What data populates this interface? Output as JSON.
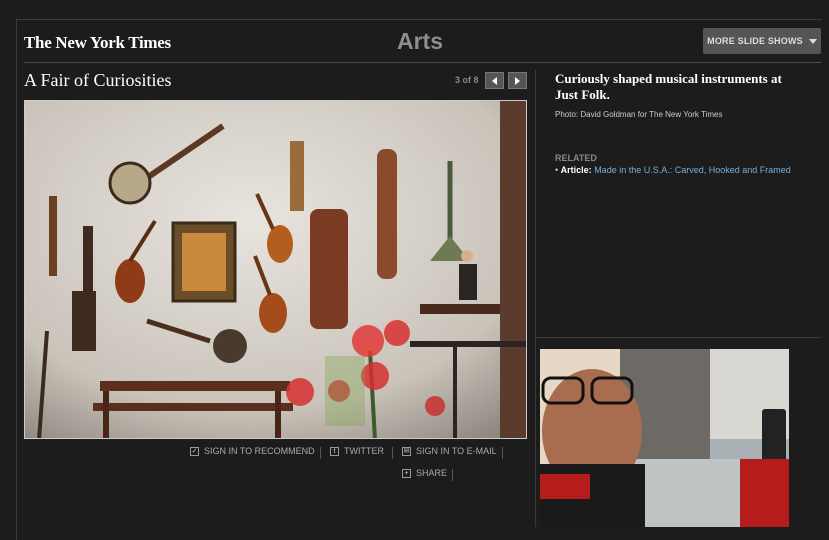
{
  "header": {
    "logo": "The New York Times",
    "section": "Arts",
    "more_button": "MORE SLIDE SHOWS"
  },
  "slideshow": {
    "title": "A Fair of Curiosities",
    "counter": "3 of 8"
  },
  "caption": {
    "text": "Curiously shaped musical instruments at Just Folk.",
    "credit": "Photo: David Goldman for The New York Times"
  },
  "related": {
    "heading": "RELATED",
    "article_label": "Article:",
    "article_link": "Made in the U.S.A.: Carved, Hooked and Framed"
  },
  "tools": {
    "recommend": "SIGN IN TO RECOMMEND",
    "twitter": "TWITTER",
    "email": "SIGN IN TO E-MAIL",
    "share": "SHARE"
  },
  "icons": [
    "checkbox-icon",
    "twitter-icon",
    "email-icon",
    "plus-icon",
    "chevron-down-icon",
    "arrow-left-icon",
    "arrow-right-icon"
  ]
}
